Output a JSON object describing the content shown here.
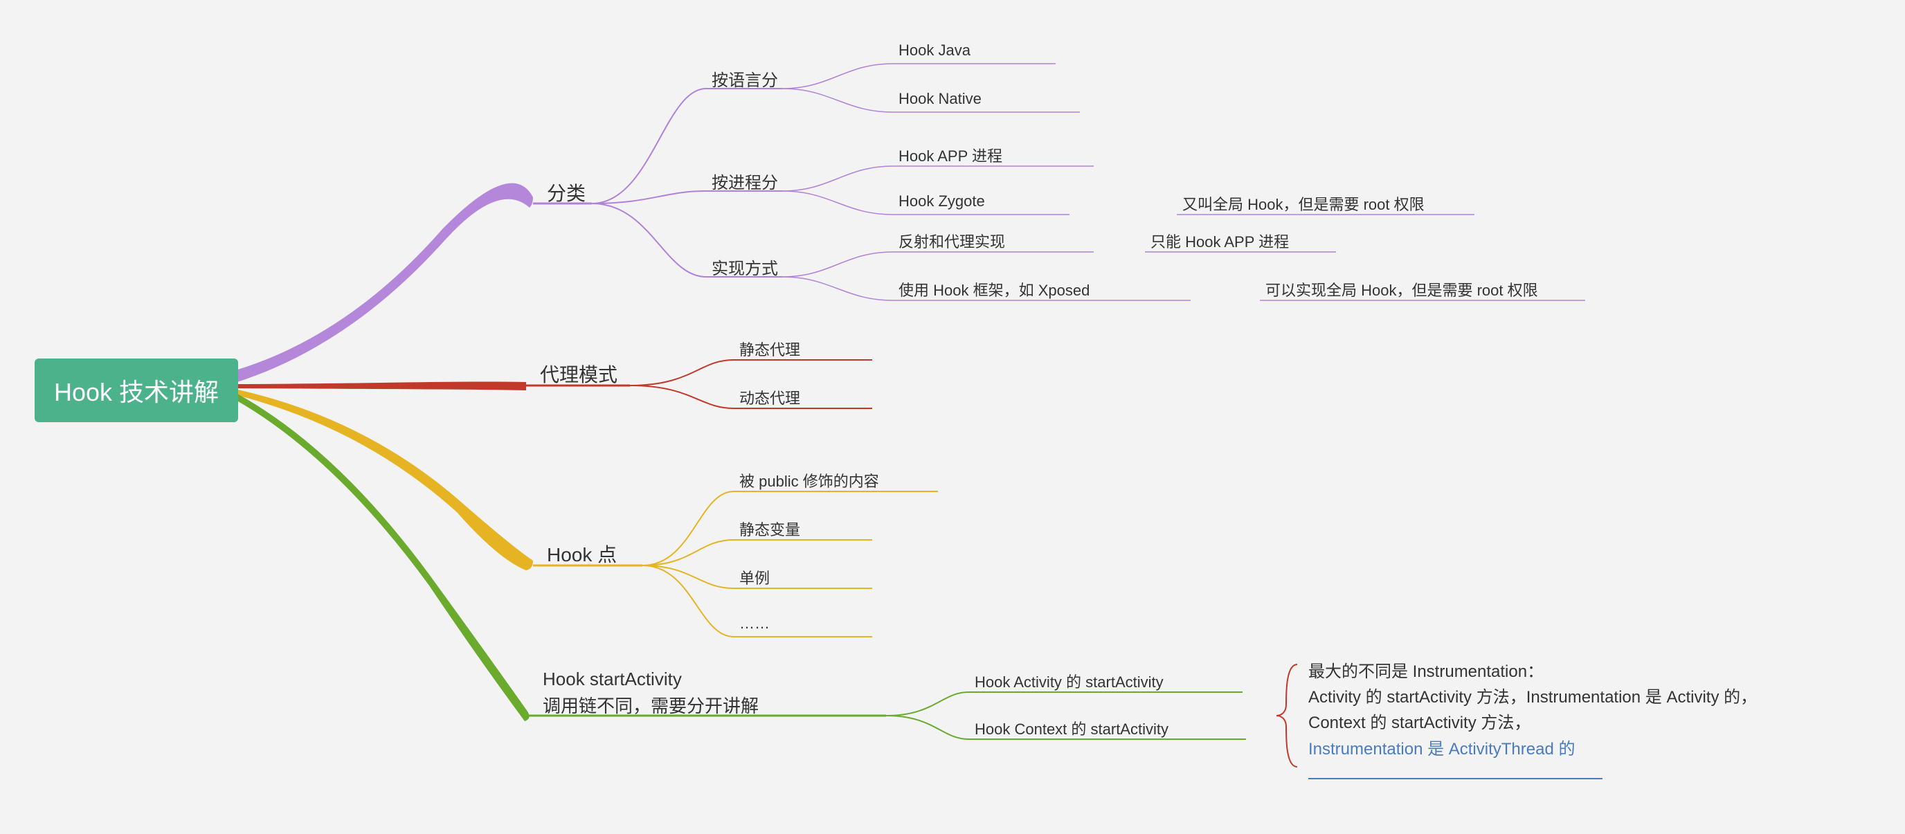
{
  "root": {
    "title": "Hook 技术讲解"
  },
  "branch1": {
    "title": "分类",
    "children": [
      {
        "title": "按语言分",
        "children": [
          {
            "title": "Hook Java"
          },
          {
            "title": "Hook Native"
          }
        ]
      },
      {
        "title": "按进程分",
        "children": [
          {
            "title": "Hook APP 进程"
          },
          {
            "title": "Hook Zygote",
            "note": "又叫全局 Hook，但是需要 root 权限"
          }
        ]
      },
      {
        "title": "实现方式",
        "children": [
          {
            "title": "反射和代理实现",
            "note": "只能 Hook APP 进程"
          },
          {
            "title": "使用 Hook 框架，如 Xposed",
            "note": "可以实现全局 Hook，但是需要 root 权限"
          }
        ]
      }
    ]
  },
  "branch2": {
    "title": "代理模式",
    "children": [
      {
        "title": "静态代理"
      },
      {
        "title": "动态代理"
      }
    ]
  },
  "branch3": {
    "title": "Hook 点",
    "children": [
      {
        "title": "被 public 修饰的内容"
      },
      {
        "title": "静态变量"
      },
      {
        "title": "单例"
      },
      {
        "title": "……"
      }
    ]
  },
  "branch4": {
    "title_line1": "Hook startActivity",
    "title_line2": "调用链不同，需要分开讲解",
    "children": [
      {
        "title": "Hook Activity 的 startActivity"
      },
      {
        "title": "Hook Context 的 startActivity"
      }
    ],
    "annotation_line1": "最大的不同是 Instrumentation：",
    "annotation_line2": "Activity 的 startActivity 方法，Instrumentation 是 Activity 的，",
    "annotation_line3": "Context 的 startActivity 方法，",
    "annotation_line4": "Instrumentation 是 ActivityThread 的"
  },
  "colors": {
    "purple": "#b081d9",
    "red": "#c0392b",
    "yellow": "#e6b422",
    "green": "#6aaa2d"
  }
}
